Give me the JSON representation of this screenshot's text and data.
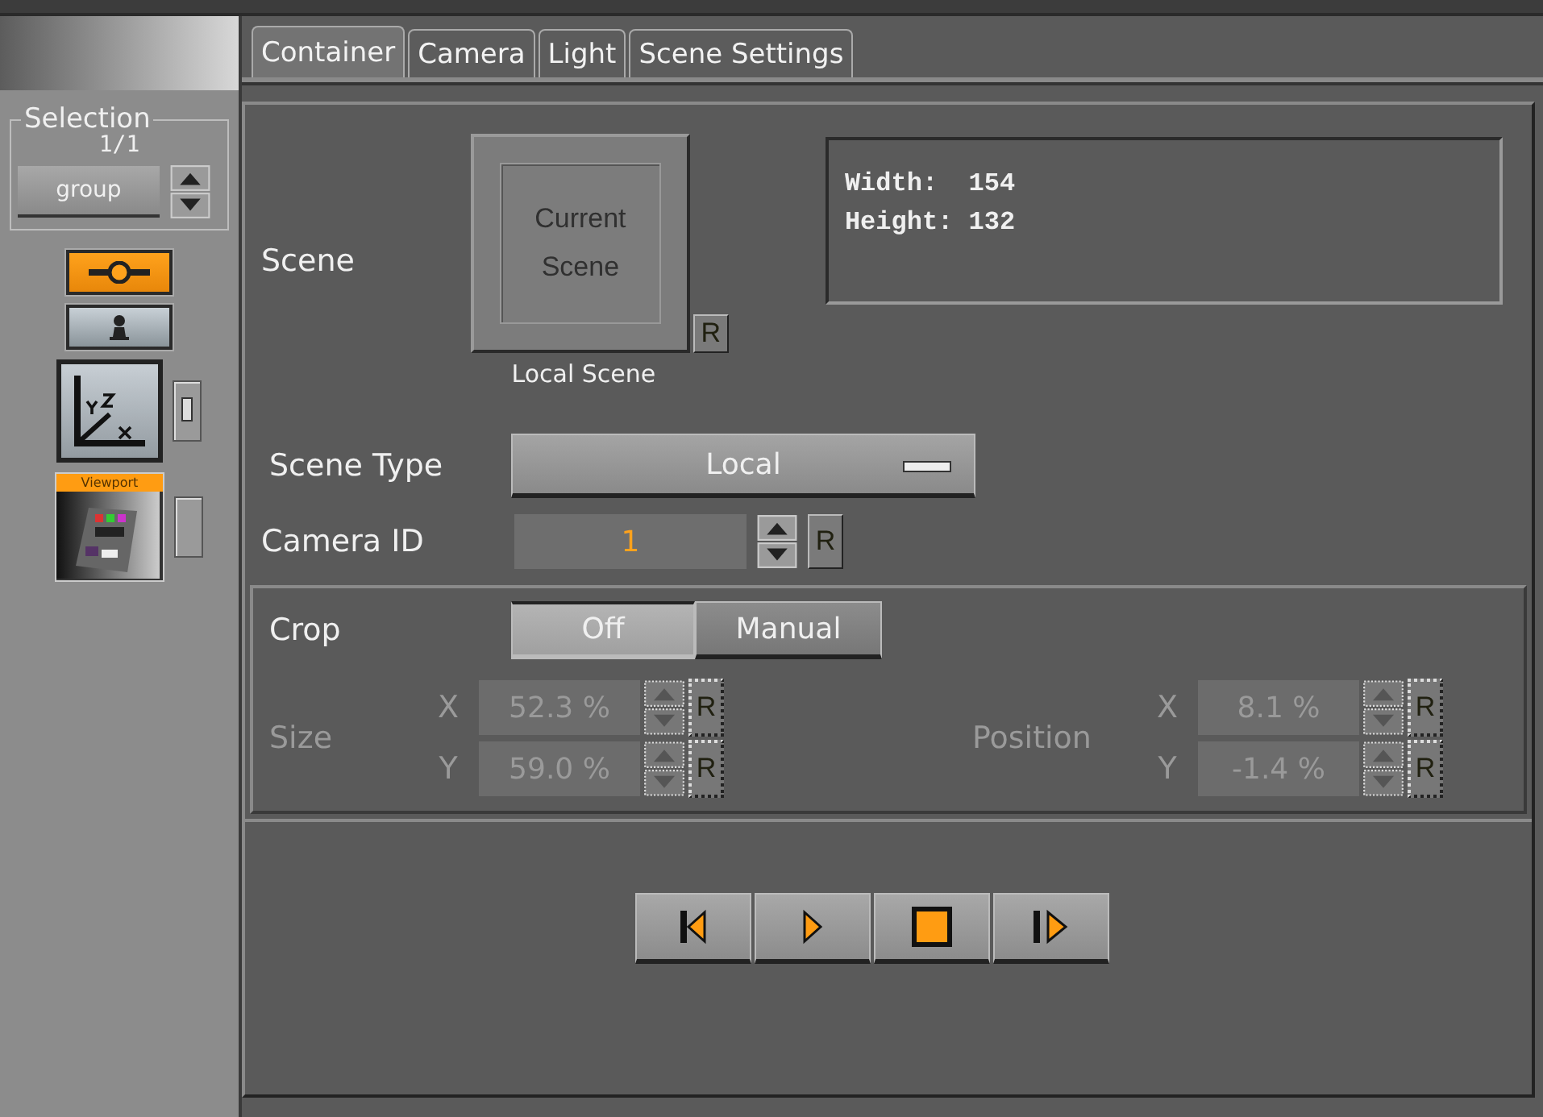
{
  "tabs": [
    {
      "label": "Container",
      "selected": true
    },
    {
      "label": "Camera",
      "selected": false
    },
    {
      "label": "Light",
      "selected": false
    },
    {
      "label": "Scene Settings",
      "selected": false
    }
  ],
  "selection": {
    "title": "Selection",
    "count": "1/1",
    "value": "group"
  },
  "toggles": [
    {
      "kind": "object",
      "on": true
    },
    {
      "kind": "person",
      "on": false
    }
  ],
  "viewport": {
    "label": "Viewport"
  },
  "scene": {
    "label": "Scene",
    "button": [
      "Current",
      "Scene"
    ],
    "caption": "Local Scene",
    "reset": "R",
    "info": [
      "Width:  154",
      "Height: 132"
    ]
  },
  "scene_type": {
    "label": "Scene Type",
    "value": "Local"
  },
  "camera_id": {
    "label": "Camera ID",
    "value": "1",
    "reset": "R"
  },
  "crop": {
    "label": "Crop",
    "options": [
      {
        "label": "Off",
        "selected": true
      },
      {
        "label": "Manual",
        "selected": false
      }
    ],
    "disabled": true,
    "groups": [
      {
        "label": "Size",
        "fields": [
          {
            "axis": "X",
            "value": "52.3 %",
            "reset": "R"
          },
          {
            "axis": "Y",
            "value": "59.0 %",
            "reset": "R"
          }
        ]
      },
      {
        "label": "Position",
        "fields": [
          {
            "axis": "X",
            "value": "8.1 %",
            "reset": "R"
          },
          {
            "axis": "Y",
            "value": "-1.4 %",
            "reset": "R"
          }
        ]
      }
    ]
  },
  "playback": [
    {
      "kind": "start"
    },
    {
      "kind": "play"
    },
    {
      "kind": "stop"
    },
    {
      "kind": "step"
    }
  ]
}
